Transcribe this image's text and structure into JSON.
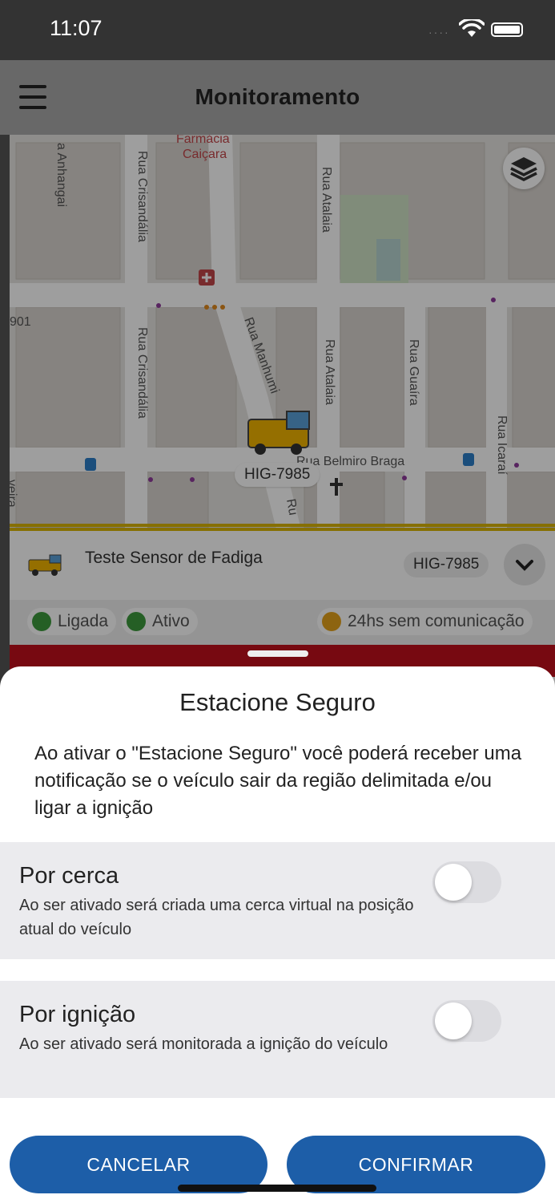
{
  "status_bar": {
    "time": "11:07"
  },
  "app_bar": {
    "title": "Monitoramento"
  },
  "map": {
    "street_labels": [
      "Farmácia",
      "Caiçara",
      "a Anhangai",
      "Rua Crisandália",
      "Rua Atalaia",
      "Rua Crisandália",
      "Rua Manhumi",
      "Rua Atalaia",
      "Rua Guaíra",
      "Rua Icaraí",
      "Rua Belmiro Braga",
      "Ru",
      "veira",
      "901"
    ],
    "vehicle_plate_label": "HIG-7985"
  },
  "vehicle_card": {
    "name": "Teste Sensor de Fadiga",
    "plate": "HIG-7985",
    "chips": [
      {
        "label": "Ligada",
        "color": "#3c9a3c",
        "icon": "key-icon"
      },
      {
        "label": "Ativo",
        "color": "#3c9a3c",
        "icon": "signal-icon"
      },
      {
        "label": "24hs sem comunicação",
        "color": "#e4a21b",
        "icon": "warning-icon"
      }
    ]
  },
  "sheet": {
    "title": "Estacione Seguro",
    "description": "Ao ativar o \"Estacione Seguro\" você poderá receber uma notificação se o veículo sair da região delimitada e/ou ligar a ignição",
    "options": [
      {
        "title": "Por cerca",
        "description": "Ao ser ativado será criada uma cerca virtual na posição atual do veículo",
        "enabled": false
      },
      {
        "title": "Por ignição",
        "description": "Ao ser ativado será monitorada a ignição do veículo",
        "enabled": false
      }
    ],
    "cancel_label": "CANCELAR",
    "confirm_label": "CONFIRMAR"
  },
  "colors": {
    "primary": "#1d5ea8",
    "accent_yellow": "#d8b400",
    "alert_red": "#c0101c"
  }
}
